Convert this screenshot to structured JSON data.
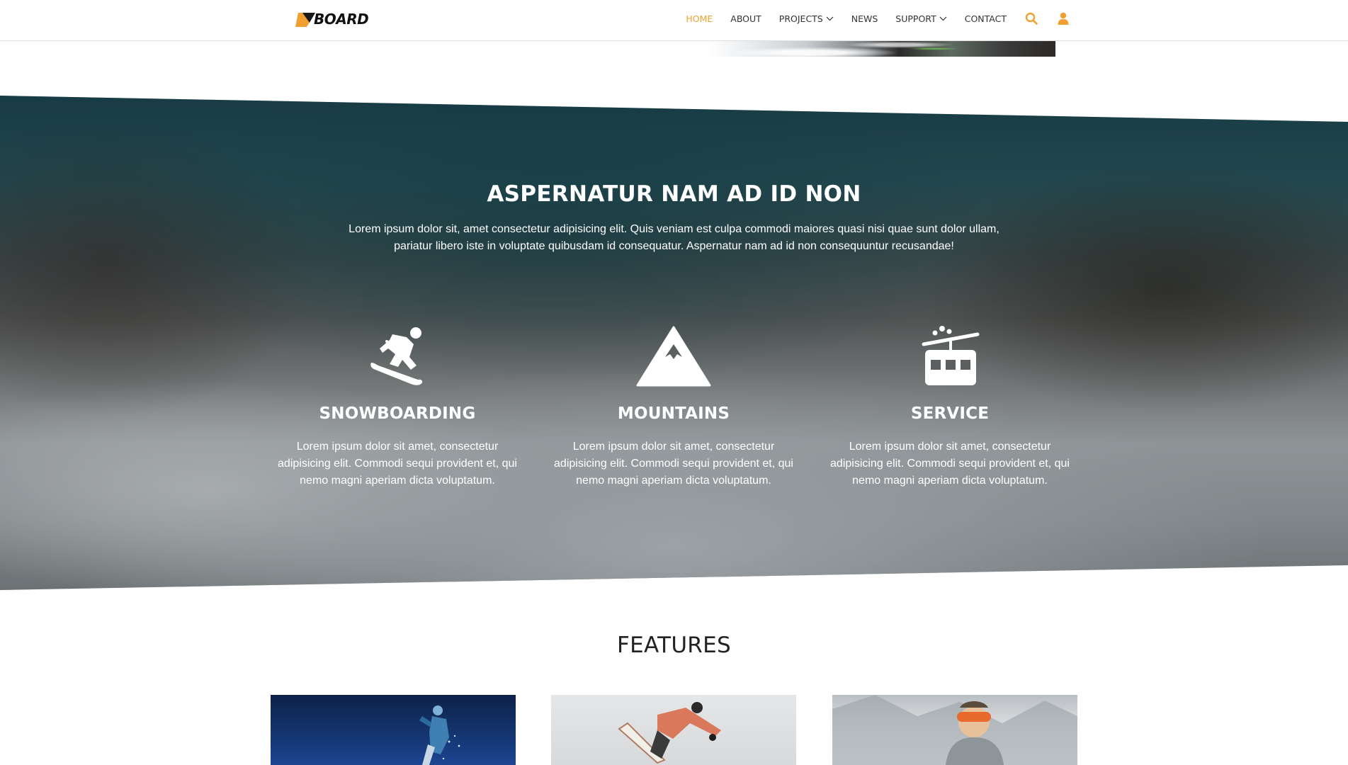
{
  "brand": {
    "logo_text": "BOARD",
    "accent_color": "#f0a030"
  },
  "nav": {
    "items": [
      {
        "label": "HOME",
        "active": true
      },
      {
        "label": "ABOUT",
        "active": false
      },
      {
        "label": "PROJECTS",
        "active": false,
        "dropdown": true
      },
      {
        "label": "NEWS",
        "active": false
      },
      {
        "label": "SUPPORT",
        "active": false,
        "dropdown": true
      },
      {
        "label": "CONTACT",
        "active": false
      }
    ],
    "icons": [
      "search-icon",
      "user-icon"
    ]
  },
  "about": {
    "title": "ASPERNATUR NAM AD ID NON",
    "lead": "Lorem ipsum dolor sit, amet consectetur adipisicing elit. Quis veniam est culpa commodi maiores quasi nisi quae sunt dolor ullam, pariatur libero iste in voluptate quibusdam id consequatur. Aspernatur nam ad id non consequuntur recusandae!",
    "features": [
      {
        "icon": "snowboarder-icon",
        "title": "SNOWBOARDING",
        "text": "Lorem ipsum dolor sit amet, consectetur adipisicing elit. Commodi sequi provident et, qui nemo magni aperiam dicta voluptatum."
      },
      {
        "icon": "mountain-icon",
        "title": "MOUNTAINS",
        "text": "Lorem ipsum dolor sit amet, consectetur adipisicing elit. Commodi sequi provident et, qui nemo magni aperiam dicta voluptatum."
      },
      {
        "icon": "cable-car-icon",
        "title": "SERVICE",
        "text": "Lorem ipsum dolor sit amet, consectetur adipisicing elit. Commodi sequi provident et, qui nemo magni aperiam dicta voluptatum."
      }
    ]
  },
  "features_section": {
    "title": "FEATURES"
  }
}
